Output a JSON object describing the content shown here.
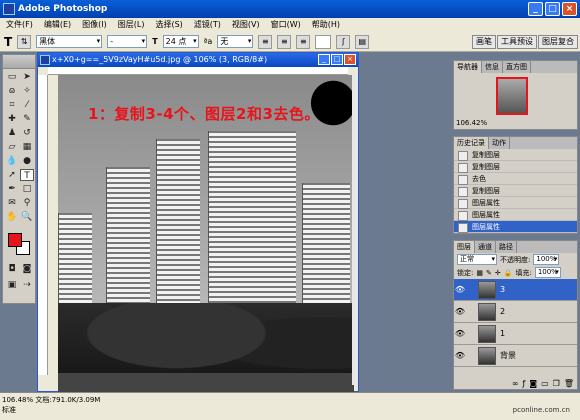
{
  "app": {
    "title": "Adobe Photoshop"
  },
  "menu": [
    "文件(F)",
    "编辑(E)",
    "图像(I)",
    "图层(L)",
    "选择(S)",
    "滤镜(T)",
    "视图(V)",
    "窗口(W)",
    "帮助(H)"
  ],
  "options": {
    "tool_glyph": "T",
    "font_family": "黑体",
    "font_style": "-",
    "font_size": "24 点",
    "aa_label": "ªa",
    "aa_value": "无",
    "tabs": [
      "画笔",
      "工具预设",
      "图层复合"
    ]
  },
  "document": {
    "title": "x+X0+g==_5V9zVayH#u5d.jpg @ 106% (3, RGB/8#)",
    "annotation": "1：复制3-4个、图层2和3去色。"
  },
  "navigator": {
    "tabs": [
      "导航器",
      "信息",
      "直方图"
    ],
    "zoom": "106.42%"
  },
  "history": {
    "tabs": [
      "历史记录",
      "动作"
    ],
    "items": [
      "复制图层",
      "复制图层",
      "去色",
      "复制图层",
      "图层属性",
      "图层属性",
      "图层属性"
    ],
    "active_index": 6
  },
  "layers": {
    "tabs": [
      "图层",
      "通道",
      "路径"
    ],
    "blend_mode": "正常",
    "opacity_label": "不透明度:",
    "opacity_value": "100%",
    "lock_label": "锁定:",
    "fill_label": "填充:",
    "fill_value": "100%",
    "items": [
      {
        "name": "3",
        "active": true
      },
      {
        "name": "2",
        "active": false
      },
      {
        "name": "1",
        "active": false
      },
      {
        "name": "背景",
        "active": false
      }
    ]
  },
  "status": {
    "zoom_doc": "106.48% 文档:791.0K/3.09M",
    "mode_label": "标准",
    "watermark": "pconline.com.cn"
  },
  "colors": {
    "foreground": "#e8141c",
    "background": "#ffffff",
    "titlebar": "#0a5fd8"
  }
}
